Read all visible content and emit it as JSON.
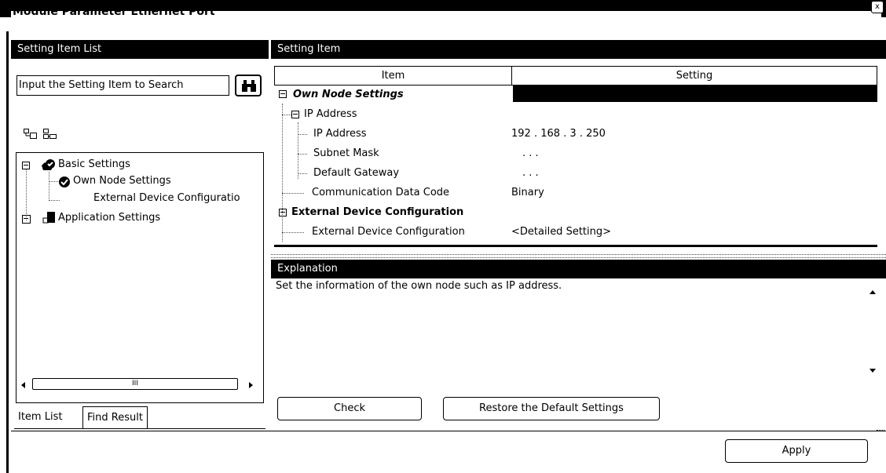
{
  "window": {
    "title": "Module Parameter Ethernet Port",
    "close_label": "x"
  },
  "left_panel": {
    "header": "Setting Item List",
    "search_placeholder": "Input the Setting Item to Search",
    "tree": {
      "basic_settings": "Basic Settings",
      "own_node_settings": "Own Node Settings",
      "external_device_configuration": "External Device Configuratio",
      "application_settings": "Application Settings"
    },
    "tabs": {
      "item_list": "Item List",
      "find_result": "Find Result"
    },
    "scroll_thumb": "III"
  },
  "right_panel": {
    "header": "Setting Item",
    "columns": {
      "item": "Item",
      "setting": "Setting"
    },
    "rows": {
      "own_node": "Own Node Settings",
      "ip_group": "IP Address",
      "ip_address": "IP Address",
      "ip_value": "192 . 168 .   3 . 250",
      "subnet_mask": "Subnet Mask",
      "subnet_value": ".       .       .",
      "default_gateway": "Default Gateway",
      "gateway_value": ".       .       .",
      "comm_code": "Communication Data Code",
      "comm_value": "Binary",
      "ext_dev_group": "External Device Configuration",
      "ext_dev": "External Device Configuration",
      "ext_dev_value": "<Detailed Setting>"
    }
  },
  "explanation": {
    "header": "Explanation",
    "text": "Set the information of the own node such as IP address."
  },
  "buttons": {
    "check": "Check",
    "restore": "Restore the Default Settings",
    "apply": "Apply"
  }
}
